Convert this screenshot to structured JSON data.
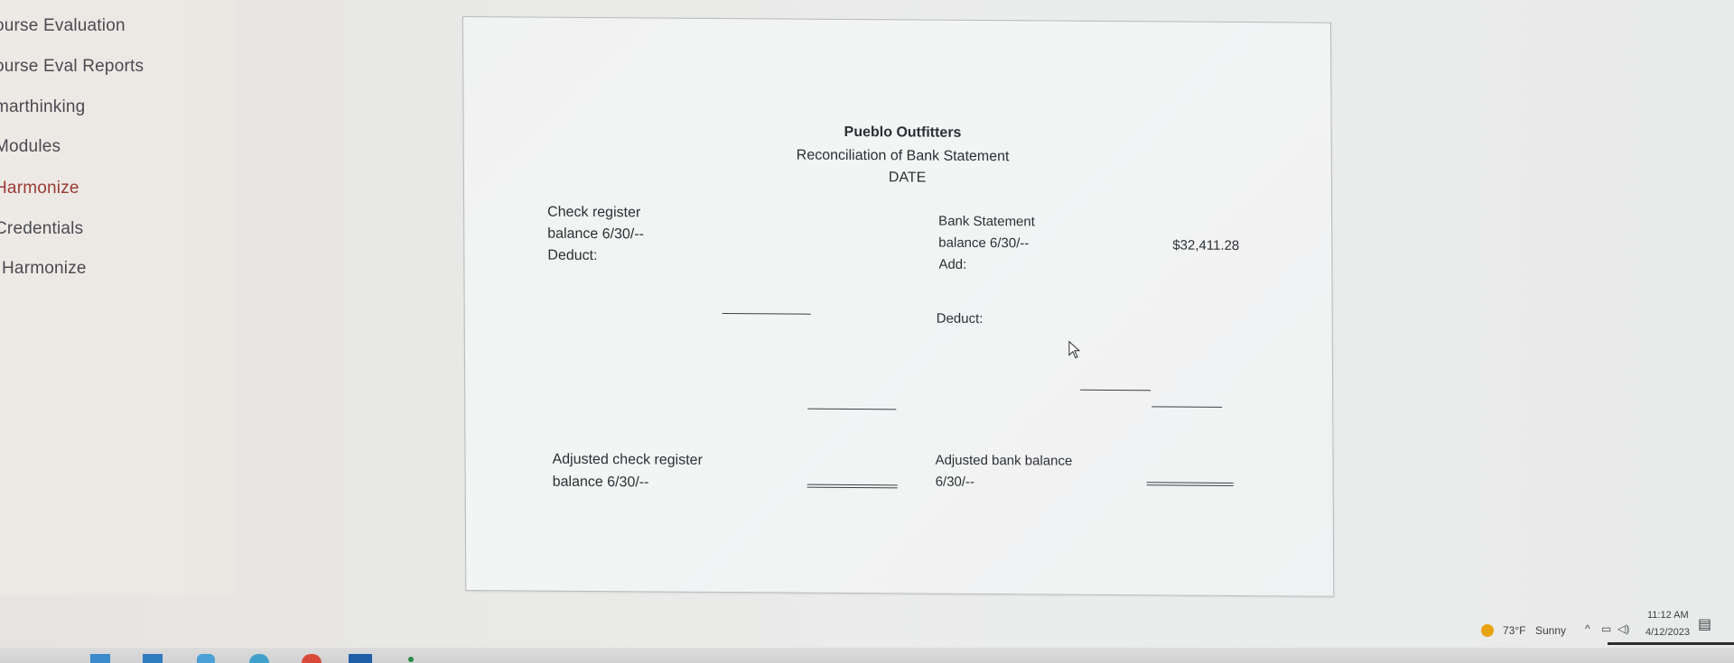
{
  "sidebar": {
    "items": [
      {
        "label": "ourse Evaluation"
      },
      {
        "label": "ourse Eval Reports"
      },
      {
        "label": "marthinking"
      },
      {
        "label": "Modules"
      },
      {
        "label": "Harmonize"
      },
      {
        "label": "Credentials"
      },
      {
        "label": "Harmonize"
      }
    ]
  },
  "document": {
    "company": "Pueblo Outfitters",
    "title": "Reconciliation of Bank Statement",
    "date": "DATE",
    "left": {
      "check_register": "Check register",
      "balance": "balance 6/30/--",
      "deduct": "Deduct:",
      "adjusted_label": "Adjusted check register",
      "adjusted_balance": "balance 6/30/--"
    },
    "right": {
      "bank_statement": "Bank Statement",
      "balance": "balance 6/30/--",
      "balance_amount": "$32,411.28",
      "add": "Add:",
      "deduct": "Deduct:",
      "adjusted_label": "Adjusted bank balance",
      "adjusted_date": "6/30/--"
    }
  },
  "tray": {
    "weather_temp": "73°F",
    "weather_desc": "Sunny",
    "time": "11:12 AM",
    "date": "4/12/2023",
    "icons": [
      "chevron-up-icon",
      "network-icon",
      "volume-icon",
      "notification-icon"
    ]
  },
  "colors": {
    "weather_sun": "#e7a20f",
    "sidebar_accent": "#9a3a34"
  }
}
